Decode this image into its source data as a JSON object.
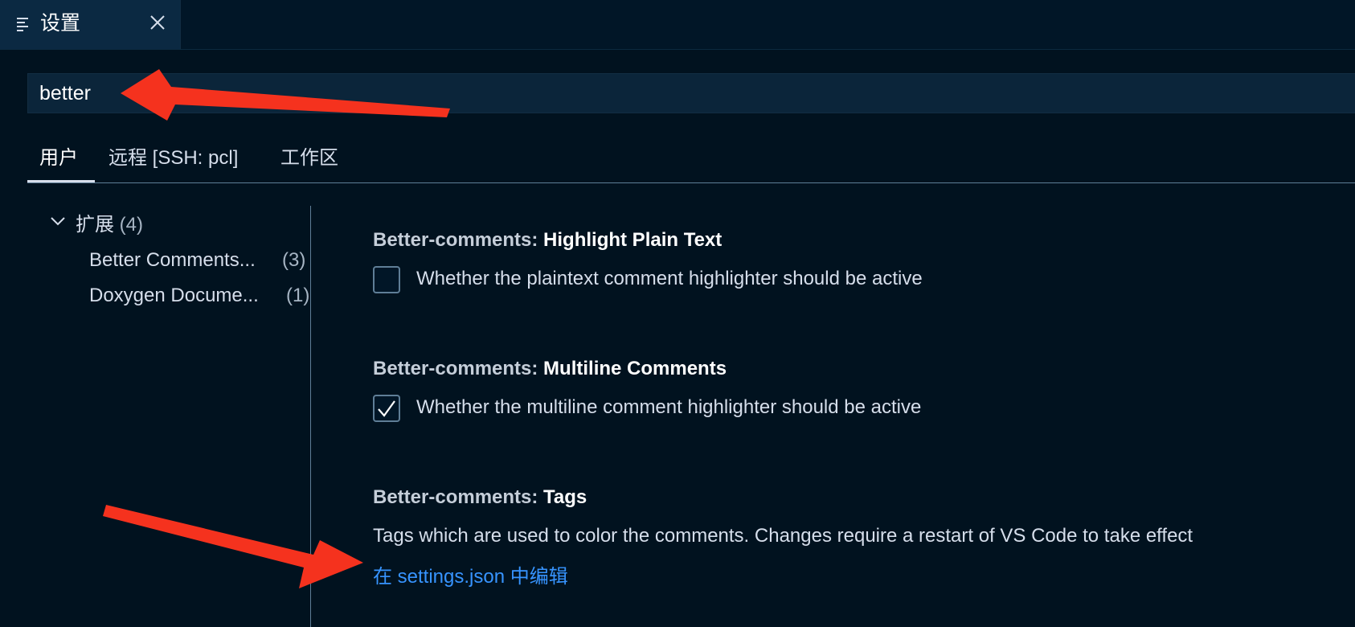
{
  "tab": {
    "title": "设置",
    "icon": "settings-list-icon"
  },
  "search": {
    "value": "better"
  },
  "scope_tabs": [
    {
      "label": "用户",
      "active": true
    },
    {
      "label": "远程 [SSH: pcl]",
      "active": false
    },
    {
      "label": "工作区",
      "active": false
    }
  ],
  "tree": {
    "group": {
      "label": "扩展",
      "count": "(4)"
    },
    "items": [
      {
        "label": "Better Comments...",
        "count": "(3)"
      },
      {
        "label": "Doxygen Docume...",
        "count": "(1)"
      }
    ]
  },
  "settings": [
    {
      "prefix": "Better-comments: ",
      "name": "Highlight Plain Text",
      "description": "Whether the plaintext comment highlighter should be active",
      "checked": false
    },
    {
      "prefix": "Better-comments: ",
      "name": "Multiline Comments",
      "description": "Whether the multiline comment highlighter should be active",
      "checked": true
    },
    {
      "prefix": "Better-comments: ",
      "name": "Tags",
      "description": "Tags which are used to color the comments. Changes require a restart of VS Code to take effect",
      "link": "在 settings.json 中编辑"
    }
  ],
  "colors": {
    "background": "#01121f",
    "link": "#3794ff",
    "annotation_arrow": "#f5321e"
  }
}
